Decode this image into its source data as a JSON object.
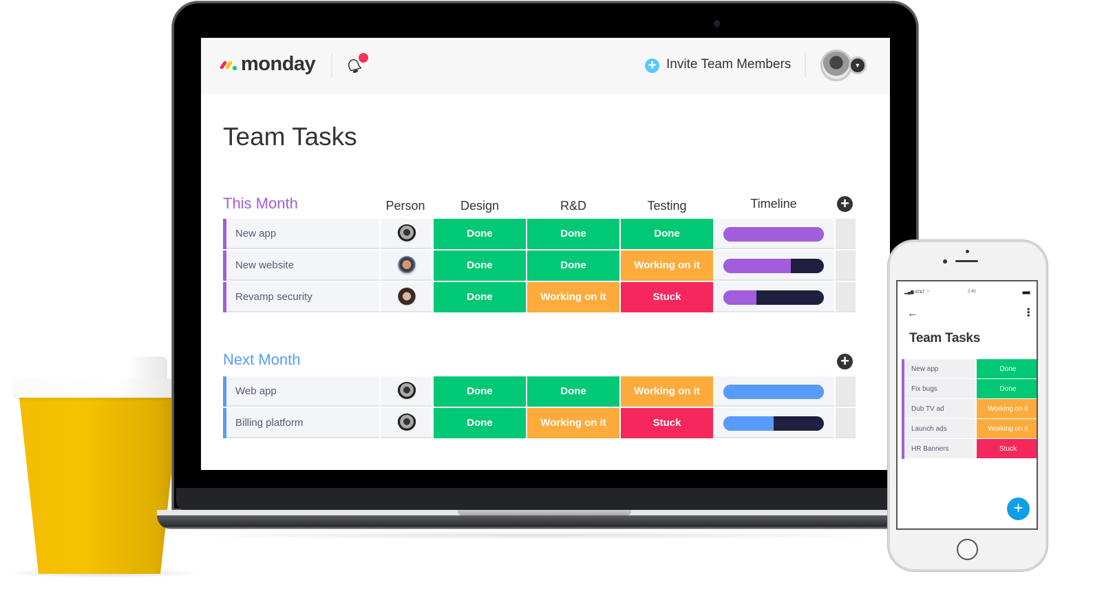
{
  "app": {
    "brand": "monday",
    "invite_label": "Invite Team Members",
    "invite_icon": "plus-circle-icon",
    "notification_icon": "bell-icon",
    "profile_caret_icon": "caret-down-icon"
  },
  "page": {
    "title": "Team Tasks"
  },
  "columns": {
    "person": "Person",
    "design": "Design",
    "rnd": "R&D",
    "testing": "Testing",
    "timeline": "Timeline",
    "add_icon": "plus-circle-icon"
  },
  "status_colors": {
    "Done": "#00c875",
    "Working on it": "#fdab3d",
    "Stuck": "#f6275d"
  },
  "groups": [
    {
      "title": "This Month",
      "color": "#a25ddc",
      "rows": [
        {
          "name": "New app",
          "person": "avatar-man-glasses",
          "design": "Done",
          "rnd": "Done",
          "testing": "Done",
          "timeline_progress": 1.0
        },
        {
          "name": "New website",
          "person": "avatar-man-beard",
          "design": "Done",
          "rnd": "Done",
          "testing": "Working on it",
          "timeline_progress": 0.67
        },
        {
          "name": "Revamp security",
          "person": "avatar-woman",
          "design": "Done",
          "rnd": "Working on it",
          "testing": "Stuck",
          "timeline_progress": 0.33
        }
      ]
    },
    {
      "title": "Next Month",
      "color": "#579bfc",
      "rows": [
        {
          "name": "Web app",
          "person": "avatar-man-glasses",
          "design": "Done",
          "rnd": "Done",
          "testing": "Working on it",
          "timeline_progress": 1.0
        },
        {
          "name": "Billing platform",
          "person": "avatar-man-glasses",
          "design": "Done",
          "rnd": "Working on it",
          "testing": "Stuck",
          "timeline_progress": 0.5
        }
      ]
    }
  ],
  "phone": {
    "carrier": "AT&T",
    "time": "2:40",
    "title": "Team Tasks",
    "back_icon": "arrow-left-icon",
    "menu_icon": "more-vertical-icon",
    "fab_icon": "plus-icon",
    "rows": [
      {
        "name": "New app",
        "status": "Done"
      },
      {
        "name": "Fix bugs",
        "status": "Done"
      },
      {
        "name": "Dub TV ad",
        "status": "Working on it"
      },
      {
        "name": "Launch ads",
        "status": "Working on it"
      },
      {
        "name": "HR Banners",
        "status": "Stuck"
      }
    ]
  }
}
